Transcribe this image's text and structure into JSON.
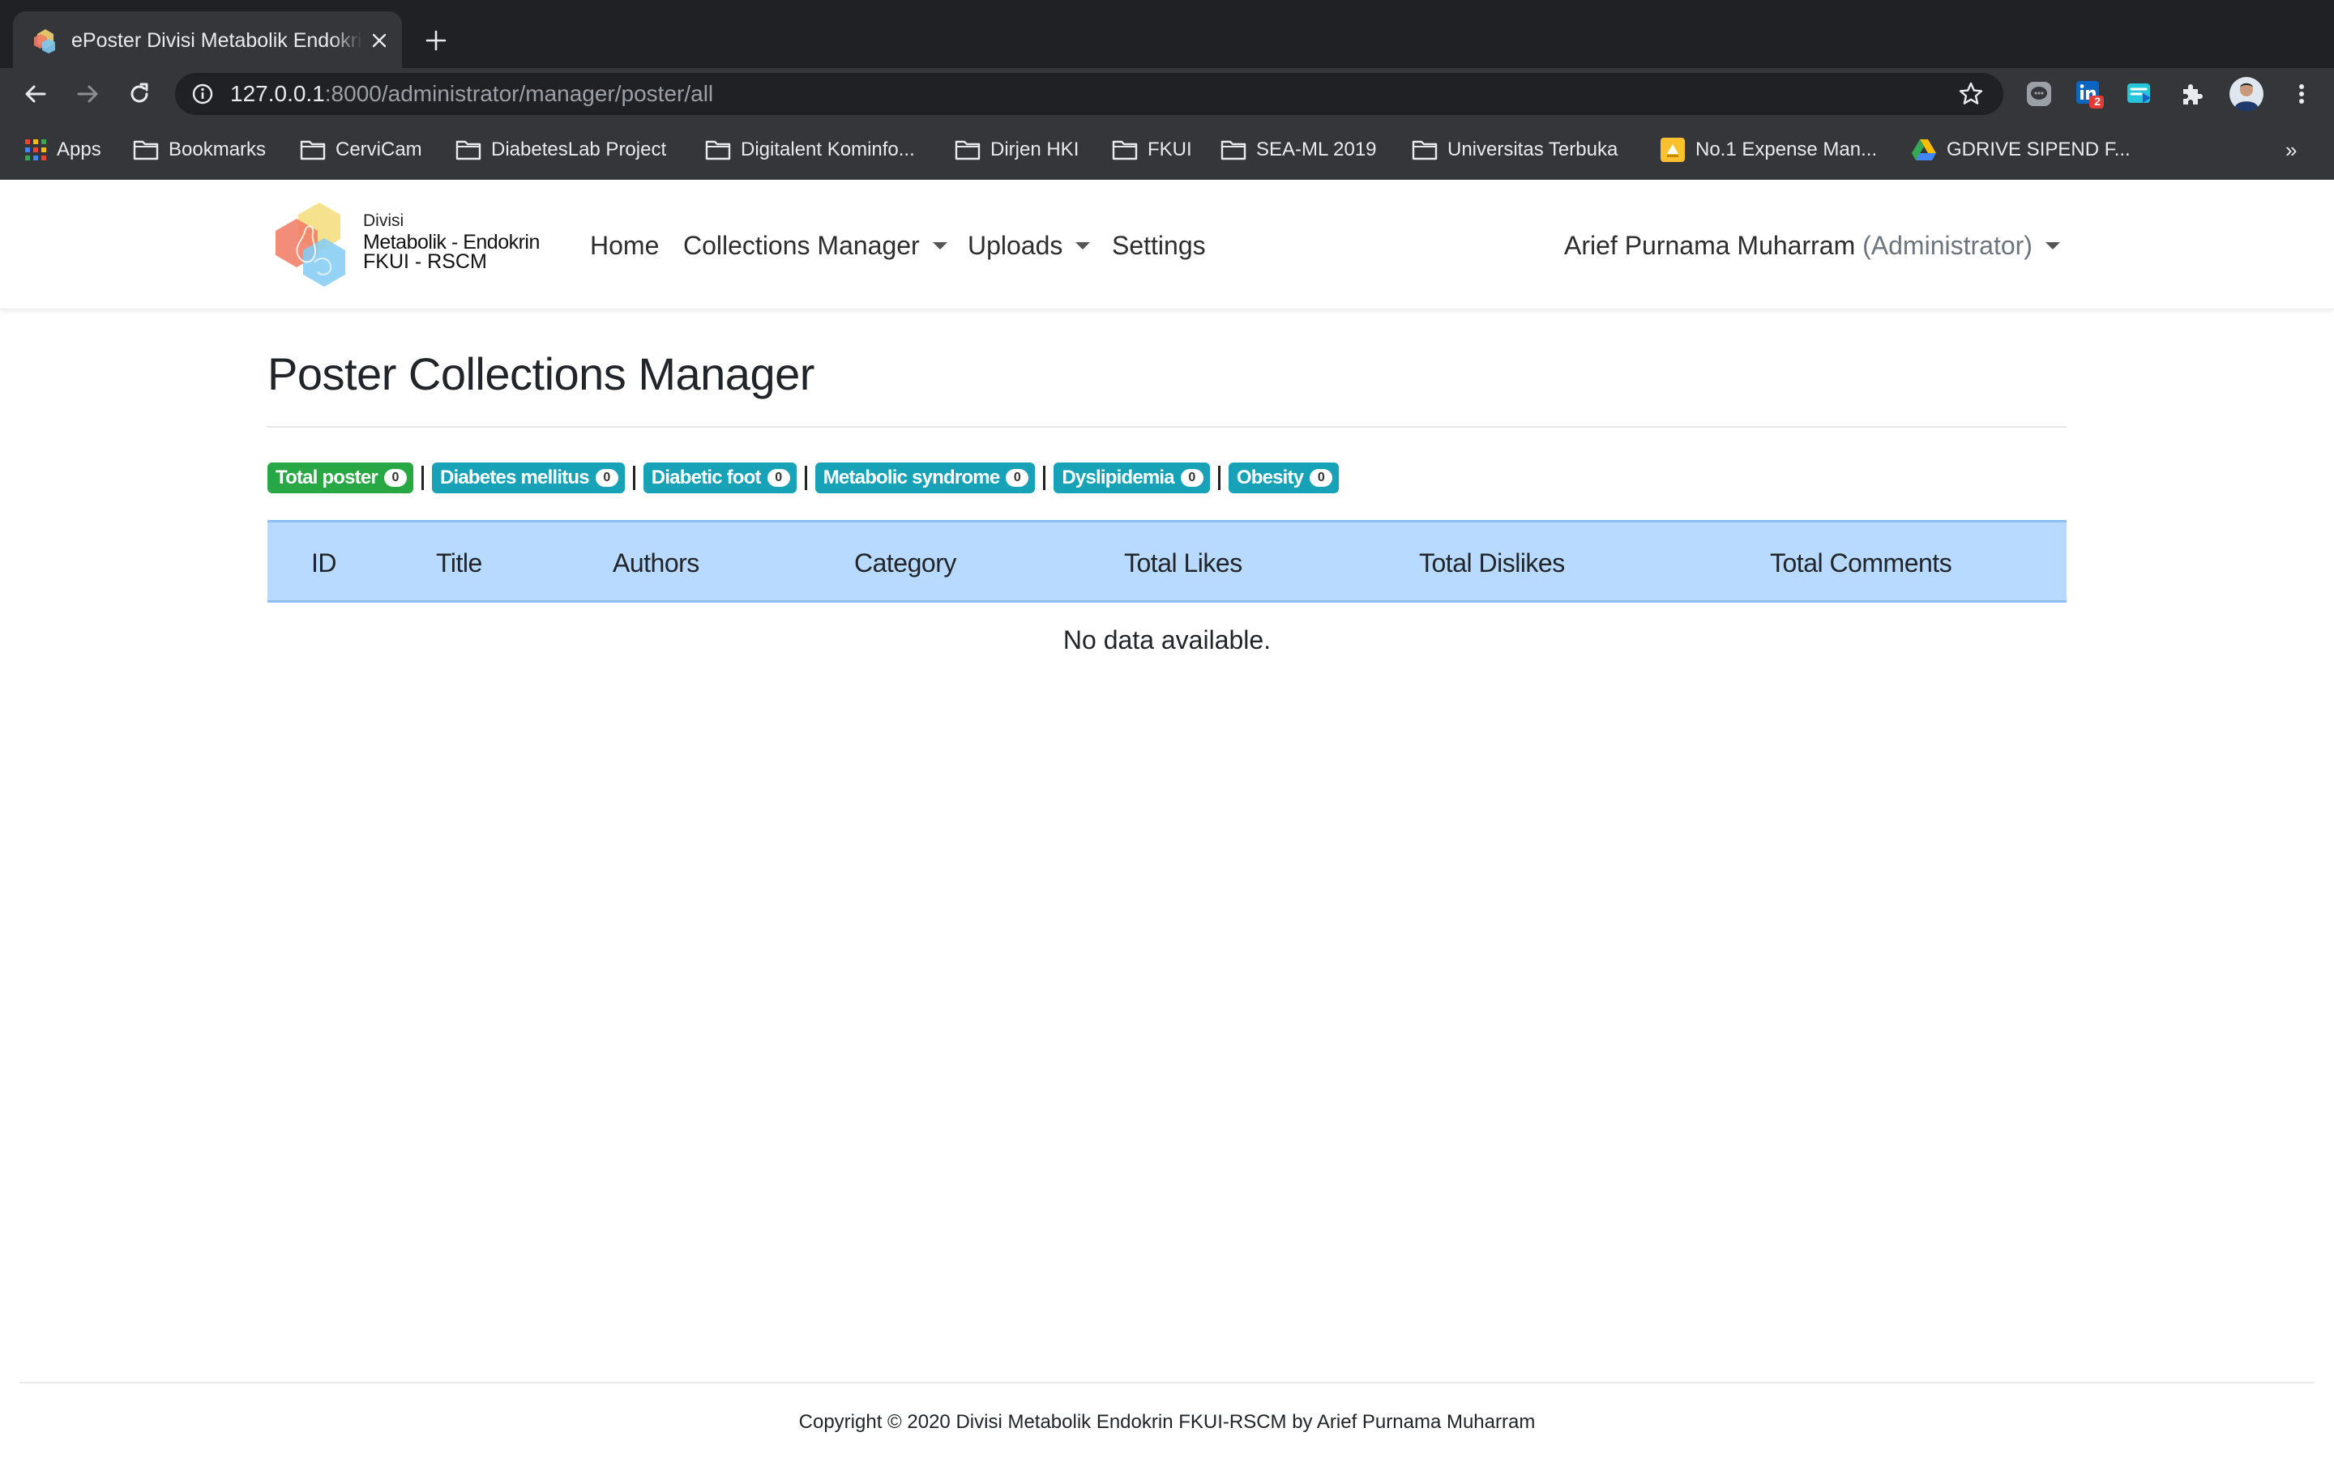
{
  "browser": {
    "tab_title": "ePoster Divisi Metabolik Endokrin FKUI-RSCM",
    "url_host": "127.0.0.1",
    "url_rest": ":8000/administrator/manager/poster/all",
    "extension_badge": "2",
    "bookmarks": [
      {
        "label": "Apps",
        "icon": "apps-grid-icon"
      },
      {
        "label": "Bookmarks",
        "icon": "folder-icon"
      },
      {
        "label": "CerviCam",
        "icon": "folder-icon"
      },
      {
        "label": "DiabetesLab Project",
        "icon": "folder-icon"
      },
      {
        "label": "Digitalent Kominfo...",
        "icon": "folder-icon"
      },
      {
        "label": "Dirjen HKI",
        "icon": "folder-icon"
      },
      {
        "label": "FKUI",
        "icon": "folder-icon"
      },
      {
        "label": "SEA-ML 2019",
        "icon": "folder-icon"
      },
      {
        "label": "Universitas Terbuka",
        "icon": "folder-icon"
      },
      {
        "label": "No.1 Expense Man...",
        "icon": "expense-app-icon"
      },
      {
        "label": "GDRIVE SIPEND F...",
        "icon": "google-drive-icon"
      }
    ],
    "bookmarks_overflow": "»"
  },
  "brand": {
    "line1": "Divisi",
    "line2": "Metabolik - Endokrin",
    "line3": "FKUI - RSCM"
  },
  "nav": {
    "home": "Home",
    "collections": "Collections Manager",
    "uploads": "Uploads",
    "settings": "Settings",
    "user_name": "Arief Purnama Muharram",
    "user_role": "(Administrator)"
  },
  "page": {
    "title": "Poster Collections Manager",
    "badges": [
      {
        "label": "Total poster",
        "count": "0",
        "color": "#28a745"
      },
      {
        "label": "Diabetes mellitus",
        "count": "0",
        "color": "#17a2b8"
      },
      {
        "label": "Diabetic foot",
        "count": "0",
        "color": "#17a2b8"
      },
      {
        "label": "Metabolic syndrome",
        "count": "0",
        "color": "#17a2b8"
      },
      {
        "label": "Dyslipidemia",
        "count": "0",
        "color": "#17a2b8"
      },
      {
        "label": "Obesity",
        "count": "0",
        "color": "#17a2b8"
      }
    ],
    "table": {
      "columns": [
        "ID",
        "Title",
        "Authors",
        "Category",
        "Total Likes",
        "Total Dislikes",
        "Total Comments"
      ],
      "empty_text": "No data available."
    }
  },
  "footer": {
    "text": "Copyright © 2020 Divisi Metabolik Endokrin FKUI-RSCM by Arief Purnama Muharram"
  },
  "colors": {
    "table_header": "#b8daff",
    "badge_success": "#28a745",
    "badge_info": "#17a2b8"
  }
}
